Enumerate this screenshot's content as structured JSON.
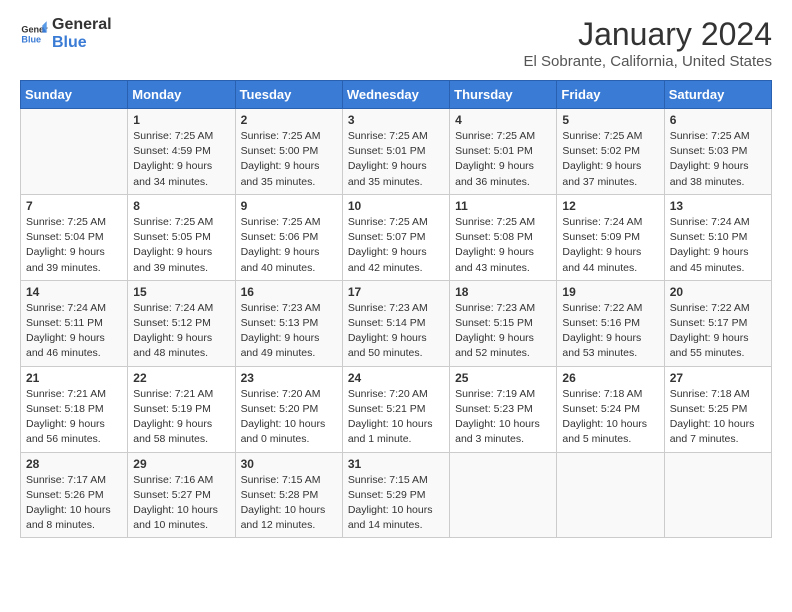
{
  "logo": {
    "general": "General",
    "blue": "Blue"
  },
  "title": "January 2024",
  "subtitle": "El Sobrante, California, United States",
  "days_of_week": [
    "Sunday",
    "Monday",
    "Tuesday",
    "Wednesday",
    "Thursday",
    "Friday",
    "Saturday"
  ],
  "weeks": [
    [
      {
        "day": "",
        "info": ""
      },
      {
        "day": "1",
        "info": "Sunrise: 7:25 AM\nSunset: 4:59 PM\nDaylight: 9 hours\nand 34 minutes."
      },
      {
        "day": "2",
        "info": "Sunrise: 7:25 AM\nSunset: 5:00 PM\nDaylight: 9 hours\nand 35 minutes."
      },
      {
        "day": "3",
        "info": "Sunrise: 7:25 AM\nSunset: 5:01 PM\nDaylight: 9 hours\nand 35 minutes."
      },
      {
        "day": "4",
        "info": "Sunrise: 7:25 AM\nSunset: 5:01 PM\nDaylight: 9 hours\nand 36 minutes."
      },
      {
        "day": "5",
        "info": "Sunrise: 7:25 AM\nSunset: 5:02 PM\nDaylight: 9 hours\nand 37 minutes."
      },
      {
        "day": "6",
        "info": "Sunrise: 7:25 AM\nSunset: 5:03 PM\nDaylight: 9 hours\nand 38 minutes."
      }
    ],
    [
      {
        "day": "7",
        "info": "Sunrise: 7:25 AM\nSunset: 5:04 PM\nDaylight: 9 hours\nand 39 minutes."
      },
      {
        "day": "8",
        "info": "Sunrise: 7:25 AM\nSunset: 5:05 PM\nDaylight: 9 hours\nand 39 minutes."
      },
      {
        "day": "9",
        "info": "Sunrise: 7:25 AM\nSunset: 5:06 PM\nDaylight: 9 hours\nand 40 minutes."
      },
      {
        "day": "10",
        "info": "Sunrise: 7:25 AM\nSunset: 5:07 PM\nDaylight: 9 hours\nand 42 minutes."
      },
      {
        "day": "11",
        "info": "Sunrise: 7:25 AM\nSunset: 5:08 PM\nDaylight: 9 hours\nand 43 minutes."
      },
      {
        "day": "12",
        "info": "Sunrise: 7:24 AM\nSunset: 5:09 PM\nDaylight: 9 hours\nand 44 minutes."
      },
      {
        "day": "13",
        "info": "Sunrise: 7:24 AM\nSunset: 5:10 PM\nDaylight: 9 hours\nand 45 minutes."
      }
    ],
    [
      {
        "day": "14",
        "info": "Sunrise: 7:24 AM\nSunset: 5:11 PM\nDaylight: 9 hours\nand 46 minutes."
      },
      {
        "day": "15",
        "info": "Sunrise: 7:24 AM\nSunset: 5:12 PM\nDaylight: 9 hours\nand 48 minutes."
      },
      {
        "day": "16",
        "info": "Sunrise: 7:23 AM\nSunset: 5:13 PM\nDaylight: 9 hours\nand 49 minutes."
      },
      {
        "day": "17",
        "info": "Sunrise: 7:23 AM\nSunset: 5:14 PM\nDaylight: 9 hours\nand 50 minutes."
      },
      {
        "day": "18",
        "info": "Sunrise: 7:23 AM\nSunset: 5:15 PM\nDaylight: 9 hours\nand 52 minutes."
      },
      {
        "day": "19",
        "info": "Sunrise: 7:22 AM\nSunset: 5:16 PM\nDaylight: 9 hours\nand 53 minutes."
      },
      {
        "day": "20",
        "info": "Sunrise: 7:22 AM\nSunset: 5:17 PM\nDaylight: 9 hours\nand 55 minutes."
      }
    ],
    [
      {
        "day": "21",
        "info": "Sunrise: 7:21 AM\nSunset: 5:18 PM\nDaylight: 9 hours\nand 56 minutes."
      },
      {
        "day": "22",
        "info": "Sunrise: 7:21 AM\nSunset: 5:19 PM\nDaylight: 9 hours\nand 58 minutes."
      },
      {
        "day": "23",
        "info": "Sunrise: 7:20 AM\nSunset: 5:20 PM\nDaylight: 10 hours\nand 0 minutes."
      },
      {
        "day": "24",
        "info": "Sunrise: 7:20 AM\nSunset: 5:21 PM\nDaylight: 10 hours\nand 1 minute."
      },
      {
        "day": "25",
        "info": "Sunrise: 7:19 AM\nSunset: 5:23 PM\nDaylight: 10 hours\nand 3 minutes."
      },
      {
        "day": "26",
        "info": "Sunrise: 7:18 AM\nSunset: 5:24 PM\nDaylight: 10 hours\nand 5 minutes."
      },
      {
        "day": "27",
        "info": "Sunrise: 7:18 AM\nSunset: 5:25 PM\nDaylight: 10 hours\nand 7 minutes."
      }
    ],
    [
      {
        "day": "28",
        "info": "Sunrise: 7:17 AM\nSunset: 5:26 PM\nDaylight: 10 hours\nand 8 minutes."
      },
      {
        "day": "29",
        "info": "Sunrise: 7:16 AM\nSunset: 5:27 PM\nDaylight: 10 hours\nand 10 minutes."
      },
      {
        "day": "30",
        "info": "Sunrise: 7:15 AM\nSunset: 5:28 PM\nDaylight: 10 hours\nand 12 minutes."
      },
      {
        "day": "31",
        "info": "Sunrise: 7:15 AM\nSunset: 5:29 PM\nDaylight: 10 hours\nand 14 minutes."
      },
      {
        "day": "",
        "info": ""
      },
      {
        "day": "",
        "info": ""
      },
      {
        "day": "",
        "info": ""
      }
    ]
  ]
}
